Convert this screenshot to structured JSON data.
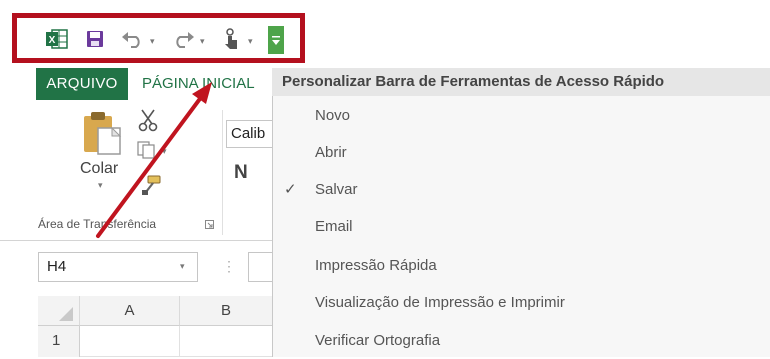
{
  "ribbon": {
    "tabs": {
      "file": "ARQUIVO",
      "home": "PÁGINA INICIAL"
    },
    "clipboard": {
      "paste_label": "Colar",
      "group_label": "Área de Transferência",
      "font_name": "Calib",
      "bold_label": "N"
    }
  },
  "name_box": {
    "value": "H4",
    "fx": "⋮"
  },
  "grid": {
    "columns": [
      "A",
      "B"
    ],
    "rows": [
      "1"
    ]
  },
  "qat_menu": {
    "title": "Personalizar Barra de Ferramentas de Acesso Rápido",
    "items": [
      {
        "label": "Novo",
        "checked": false
      },
      {
        "label": "Abrir",
        "checked": false
      },
      {
        "label": "Salvar",
        "checked": true
      },
      {
        "label": "Email",
        "checked": false
      },
      {
        "label": "Impressão Rápida",
        "checked": false
      },
      {
        "label": "Visualização de Impressão e Imprimir",
        "checked": false
      },
      {
        "label": "Verificar Ortografia",
        "checked": false
      }
    ],
    "check_glyph": "✓"
  },
  "colors": {
    "excel_green": "#217346",
    "highlight_red": "#b4101e",
    "save_purple": "#6b3a9c"
  },
  "icons": [
    "excel-icon",
    "save-icon",
    "undo-icon",
    "redo-icon",
    "touch-mode-icon",
    "customize-qat-icon",
    "paste-icon",
    "cut-icon",
    "copy-icon",
    "format-painter-icon"
  ]
}
